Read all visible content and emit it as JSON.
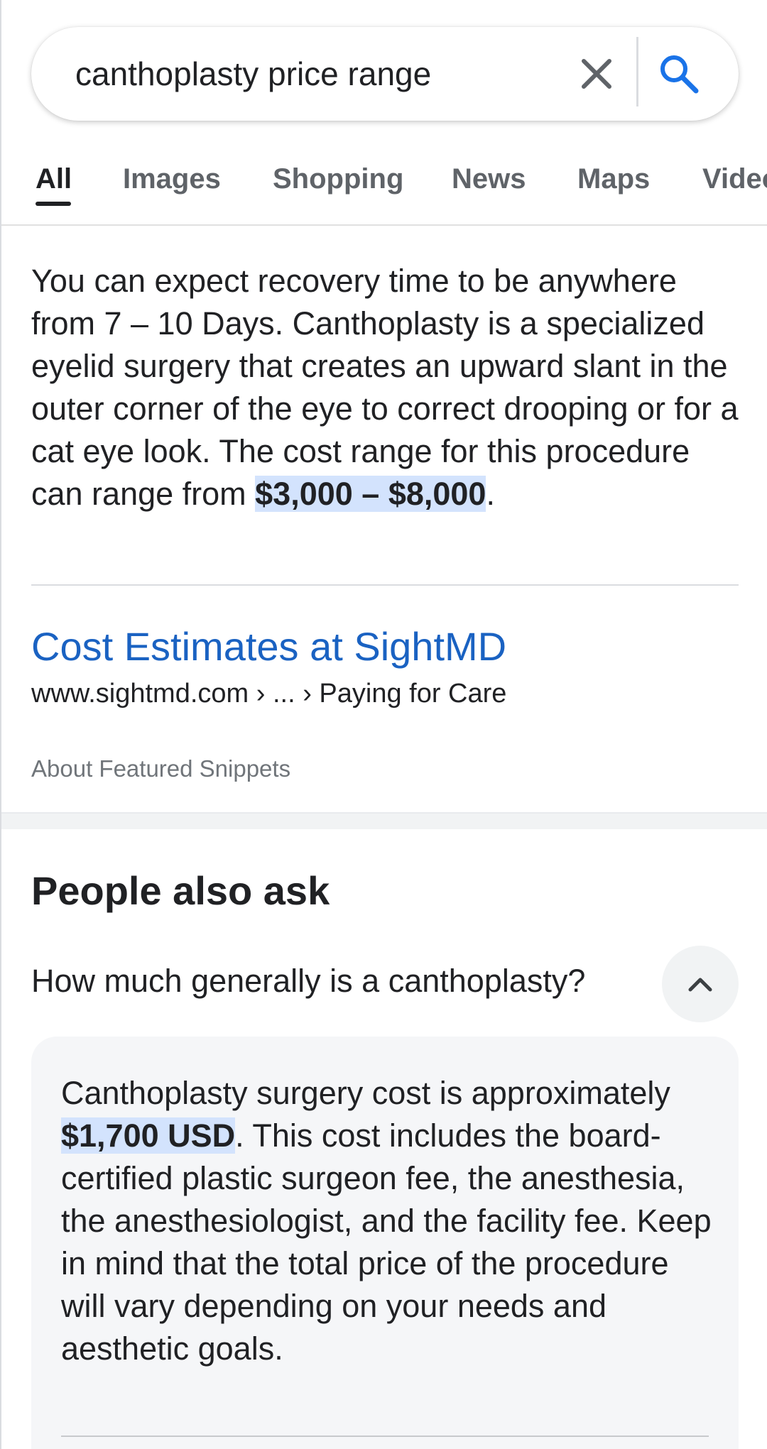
{
  "search": {
    "query": "canthoplasty price range"
  },
  "tabs": [
    {
      "label": "All"
    },
    {
      "label": "Images"
    },
    {
      "label": "Shopping"
    },
    {
      "label": "News"
    },
    {
      "label": "Maps"
    },
    {
      "label": "Videos"
    }
  ],
  "snippet": {
    "text_before": "You can expect recovery time to be anywhere from 7 – 10 Days. Canthoplasty is a specialized eyelid surgery that creates an upward slant in the outer corner of the eye to correct drooping or for a cat eye look. The cost range for this procedure can range from ",
    "highlight": "$3,000 – $8,000",
    "text_after": ".",
    "source_title": "Cost Estimates at SightMD",
    "source_url": "www.sightmd.com › ... › Paying for Care",
    "about_label": "About Featured Snippets"
  },
  "people_also_ask": {
    "title": "People also ask",
    "question": "How much generally is a canthoplasty?",
    "answer_before": "Canthoplasty surgery cost is approximately ",
    "answer_highlight": "$1,700 USD",
    "answer_after": ". This cost includes the board-certified plastic surgeon fee, the anesthesia, the anesthesiologist, and the facility fee. Keep in mind that the total price of the procedure will vary depending on your needs and aesthetic goals."
  },
  "colors": {
    "link": "#1a62c2",
    "highlight": "#d3e3fd",
    "search_icon": "#1a73e8"
  },
  "icons": {
    "clear": "close-icon",
    "search": "search-icon",
    "collapse": "chevron-up-icon"
  }
}
